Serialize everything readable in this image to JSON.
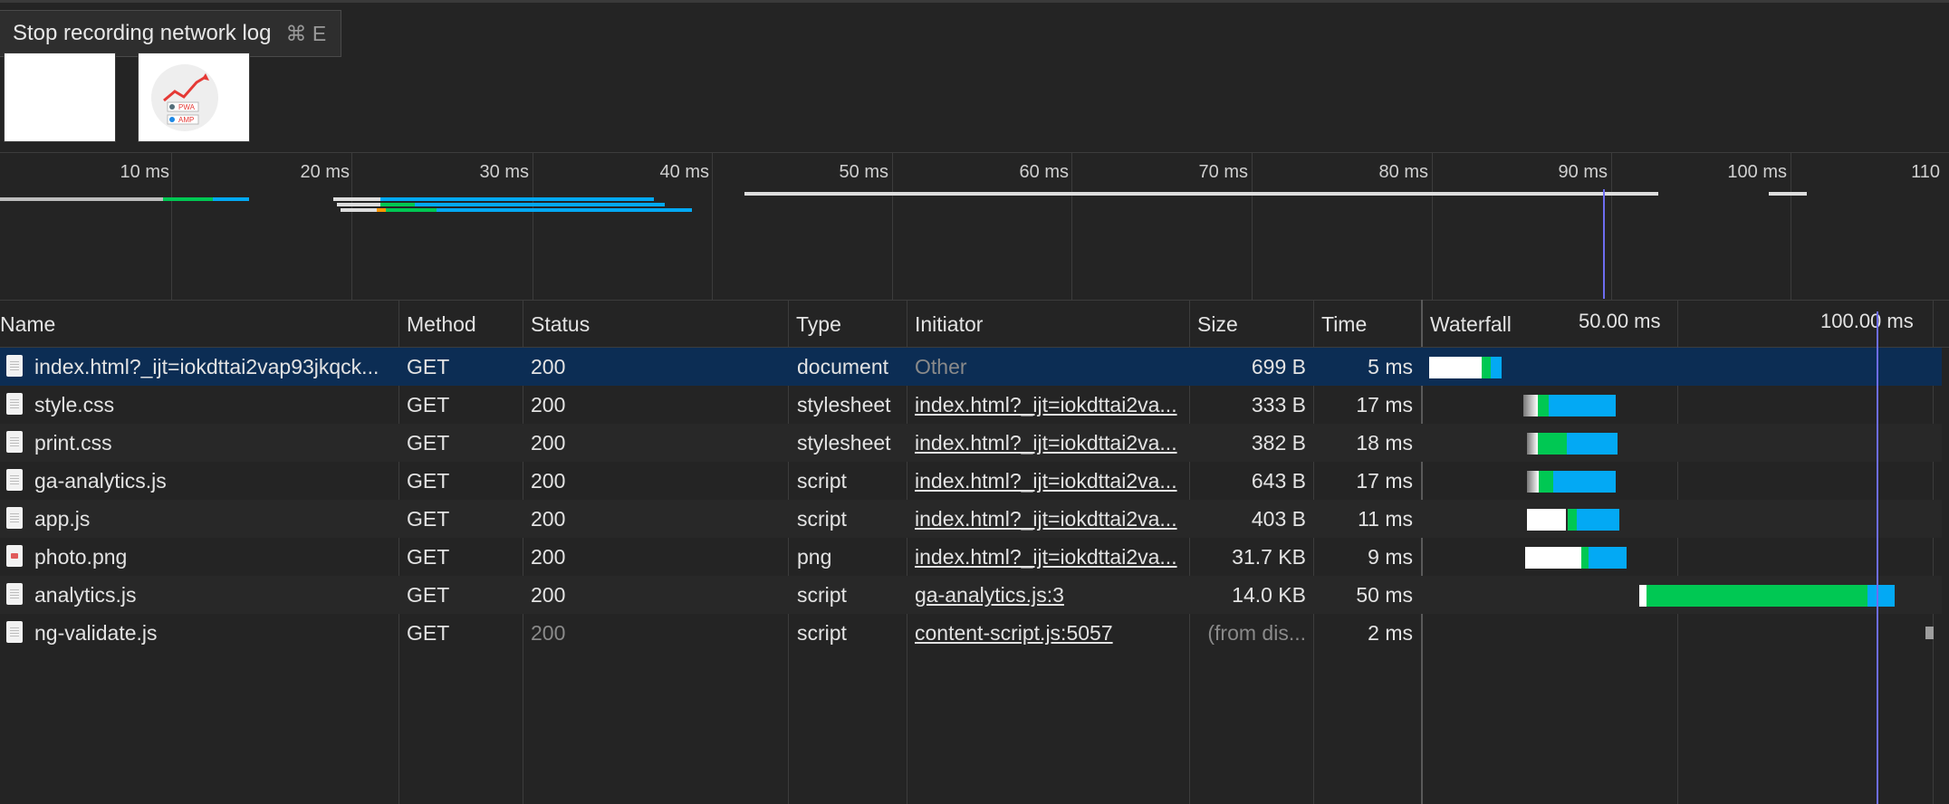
{
  "tooltip": {
    "label": "Stop recording network log",
    "shortcut": "⌘ E"
  },
  "overview": {
    "ticks": [
      "10 ms",
      "20 ms",
      "30 ms",
      "40 ms",
      "50 ms",
      "60 ms",
      "70 ms",
      "80 ms",
      "90 ms",
      "100 ms",
      "110"
    ]
  },
  "columns": {
    "name": "Name",
    "method": "Method",
    "status": "Status",
    "type": "Type",
    "initiator": "Initiator",
    "size": "Size",
    "time": "Time",
    "waterfall": "Waterfall",
    "waterfall_ticks": [
      "50.00 ms",
      "100.00 ms"
    ]
  },
  "rows": [
    {
      "name": "index.html?_ijt=iokdttai2vap93jkqck...",
      "method": "GET",
      "status": "200",
      "type": "document",
      "initiator": "Other",
      "size": "699 B",
      "time": "5 ms",
      "icon": "document-icon"
    },
    {
      "name": "style.css",
      "method": "GET",
      "status": "200",
      "type": "stylesheet",
      "initiator": "index.html?_ijt=iokdttai2va...",
      "size": "333 B",
      "time": "17 ms",
      "icon": "document-icon"
    },
    {
      "name": "print.css",
      "method": "GET",
      "status": "200",
      "type": "stylesheet",
      "initiator": "index.html?_ijt=iokdttai2va...",
      "size": "382 B",
      "time": "18 ms",
      "icon": "document-icon"
    },
    {
      "name": "ga-analytics.js",
      "method": "GET",
      "status": "200",
      "type": "script",
      "initiator": "index.html?_ijt=iokdttai2va...",
      "size": "643 B",
      "time": "17 ms",
      "icon": "document-icon"
    },
    {
      "name": "app.js",
      "method": "GET",
      "status": "200",
      "type": "script",
      "initiator": "index.html?_ijt=iokdttai2va...",
      "size": "403 B",
      "time": "11 ms",
      "icon": "document-icon"
    },
    {
      "name": "photo.png",
      "method": "GET",
      "status": "200",
      "type": "png",
      "initiator": "index.html?_ijt=iokdttai2va...",
      "size": "31.7 KB",
      "time": "9 ms",
      "icon": "image-icon"
    },
    {
      "name": "analytics.js",
      "method": "GET",
      "status": "200",
      "type": "script",
      "initiator": "ga-analytics.js:3",
      "size": "14.0 KB",
      "time": "50 ms",
      "icon": "document-icon"
    },
    {
      "name": "ng-validate.js",
      "method": "GET",
      "status": "200",
      "type": "script",
      "initiator": "content-script.js:5057",
      "size": "(from dis...",
      "time": "2 ms",
      "icon": "document-icon"
    }
  ],
  "colors": {
    "selected_row": "#0c2d54",
    "waiting": "#00c853",
    "download": "#03a9f4",
    "queue": "#ffffff",
    "marker": "#6d6df0"
  }
}
